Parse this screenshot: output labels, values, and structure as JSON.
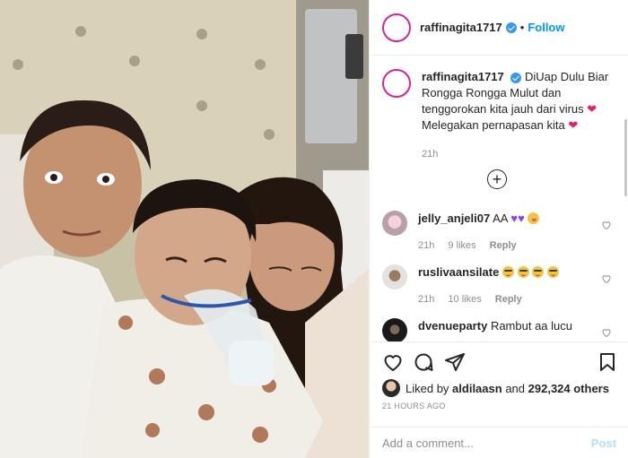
{
  "header": {
    "username": "raffinagita1717",
    "separator": "•",
    "follow_label": "Follow"
  },
  "caption": {
    "username": "raffinagita1717",
    "text": "DiUap Dulu Biar Rongga Rongga Mulut dan tenggorokan kita jauh dari virus",
    "text2": "Melegakan pernapasan kita",
    "heart": "❤",
    "time": "21h"
  },
  "load_more_label": "+",
  "comments": [
    {
      "username": "jelly_anjeli07",
      "text": "AA",
      "time": "21h",
      "likes": "9 likes",
      "reply": "Reply"
    },
    {
      "username": "ruslivaansilate",
      "text": "",
      "time": "21h",
      "likes": "10 likes",
      "reply": "Reply"
    },
    {
      "username": "dvenueparty",
      "text": "Rambut aa lucu",
      "time": "",
      "likes": "",
      "reply": ""
    }
  ],
  "likes": {
    "prefix": "Liked by",
    "user": "aldilaasn",
    "and": "and",
    "others": "292,324 others"
  },
  "posted_time": "21 HOURS AGO",
  "add_comment": {
    "placeholder": "Add a comment...",
    "post_label": "Post"
  },
  "icons": [
    "heart-icon",
    "comment-icon",
    "share-icon",
    "save-icon",
    "verified-icon",
    "add-circle-icon"
  ],
  "colors": {
    "accent": "#0095f6",
    "verified": "#3897f0",
    "heart": "#e0245e",
    "muted": "#8e8e8e",
    "border": "#efefef"
  }
}
